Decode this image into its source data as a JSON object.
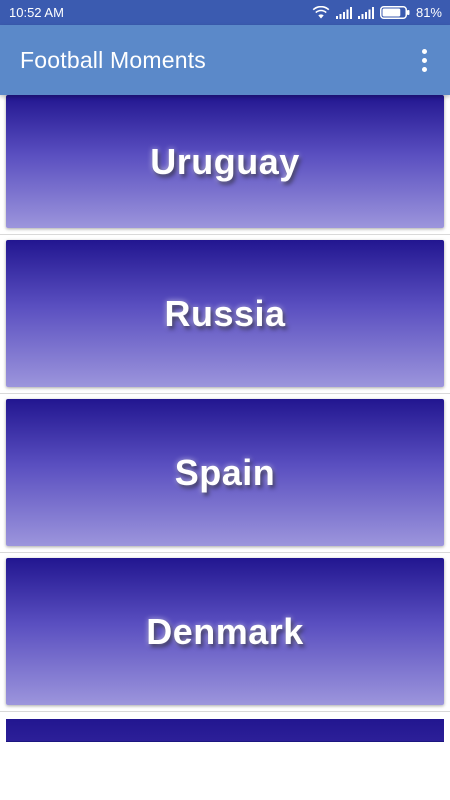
{
  "status_bar": {
    "time": "10:52 AM",
    "battery_percent": "81%",
    "battery_level": 0.81,
    "icons": [
      "wifi-icon",
      "signal-icon",
      "signal-icon",
      "battery-icon"
    ]
  },
  "app_bar": {
    "title": "Football Moments",
    "menu_icon": "overflow-menu-icon"
  },
  "teams": [
    {
      "label": "Uruguay"
    },
    {
      "label": "Russia"
    },
    {
      "label": "Spain"
    },
    {
      "label": "Denmark"
    }
  ],
  "colors": {
    "status_bar": "#3b5bb0",
    "app_bar": "#5b89c9",
    "card_top": "#221690",
    "card_bottom": "#9c95dc"
  }
}
